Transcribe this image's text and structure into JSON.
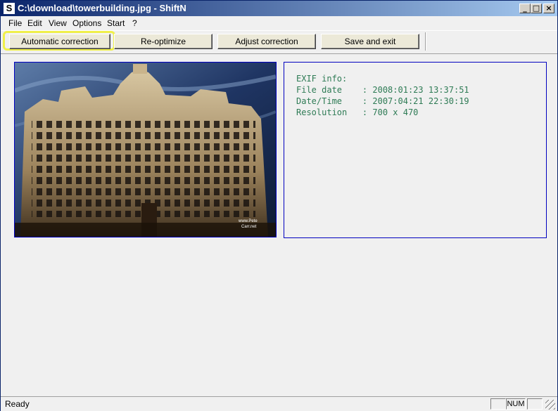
{
  "window": {
    "title": "C:\\download\\towerbuilding.jpg - ShiftN",
    "app_icon": "S"
  },
  "caption_buttons": {
    "minimize": "_",
    "maximize": "□",
    "close": "×"
  },
  "menu": [
    "File",
    "Edit",
    "View",
    "Options",
    "Start",
    "?"
  ],
  "toolbar": {
    "automatic_correction": "Automatic correction",
    "reoptimize": "Re-optimize",
    "adjust_correction": "Adjust correction",
    "save_and_exit": "Save and exit"
  },
  "image": {
    "watermark_line1": "www.Pete",
    "watermark_line2": "Carr.net"
  },
  "exif": {
    "heading": "EXIF info:",
    "file_date": "File date    : 2008:01:23 13:37:51",
    "date_time": "Date/Time    : 2007:04:21 22:30:19",
    "resolution": "Resolution   : 700 x 470"
  },
  "status": {
    "text": "Ready",
    "num": "NUM"
  }
}
